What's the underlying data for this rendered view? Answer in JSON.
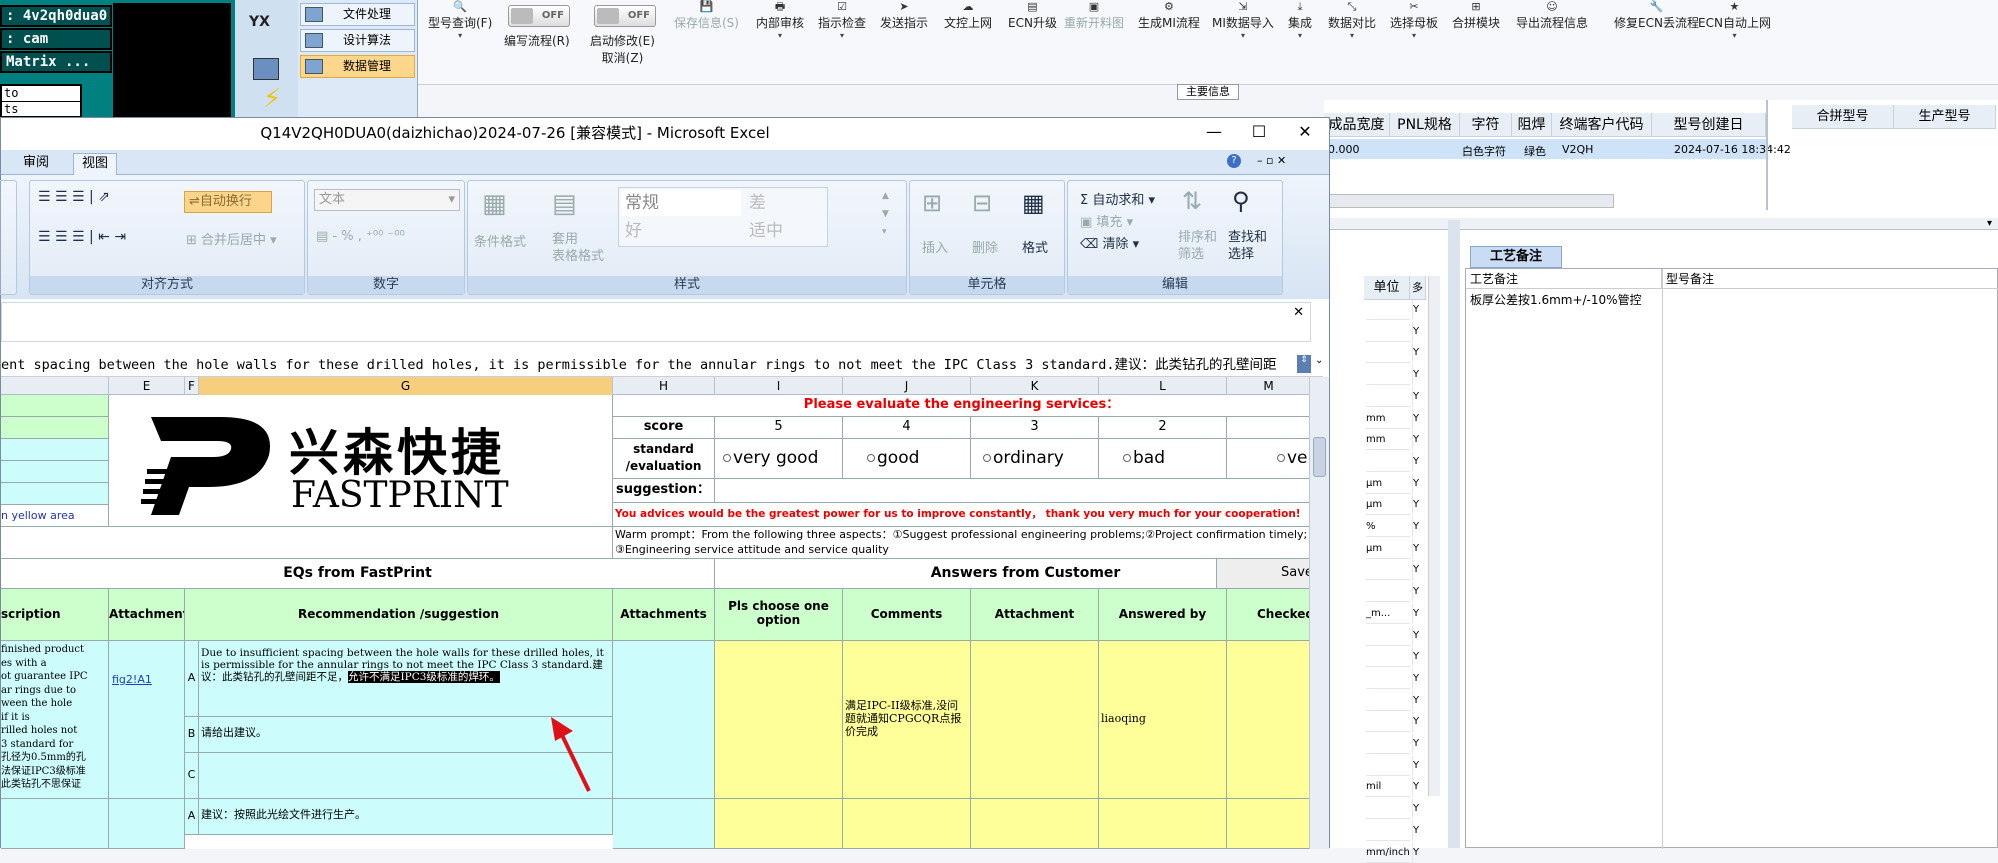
{
  "terminal": {
    "lines": [
      ": 4v2qh0dua0",
      ": cam",
      "Matrix ..."
    ],
    "input_lines": [
      "to",
      "ts"
    ]
  },
  "side_menu": {
    "items": [
      {
        "label": "文件处理",
        "selected": false
      },
      {
        "label": "设计算法",
        "selected": false
      },
      {
        "label": "数据管理",
        "selected": true
      }
    ]
  },
  "toolbar": {
    "items": [
      {
        "label": "型号查询(F)",
        "icon": "search-icon",
        "disabled": false
      },
      {
        "label": "编写流程(R)",
        "icon": "toggle",
        "disabled": false
      },
      {
        "label": "启动修改(E)",
        "icon": "toggle",
        "disabled": false
      },
      {
        "label": "保存信息(S)",
        "icon": "save-icon",
        "disabled": true
      },
      {
        "label": "内部审核",
        "icon": "print-icon",
        "disabled": false
      },
      {
        "label": "指示检查",
        "icon": "check-icon",
        "disabled": false
      },
      {
        "label": "发送指示",
        "icon": "send-icon",
        "disabled": false
      },
      {
        "label": "文控上网",
        "icon": "upload-icon",
        "disabled": false
      },
      {
        "label": "ECN升级",
        "icon": "doc-icon",
        "disabled": false
      },
      {
        "label": "重新开料图",
        "icon": "image-icon",
        "disabled": true
      },
      {
        "label": "生成MI流程",
        "icon": "flow-icon",
        "disabled": false
      },
      {
        "label": "MI数据导入",
        "icon": "import-icon",
        "disabled": false
      },
      {
        "label": "集成",
        "icon": "download-icon",
        "disabled": false
      },
      {
        "label": "数据对比",
        "icon": "compare-icon",
        "disabled": false
      },
      {
        "label": "选择母板",
        "icon": "select-icon",
        "disabled": false
      },
      {
        "label": "合拼模块",
        "icon": "merge-icon",
        "disabled": false
      },
      {
        "label": "导出流程信息",
        "icon": "export-icon",
        "disabled": false
      },
      {
        "label": "修复ECN丢流程",
        "icon": "wrench-icon",
        "disabled": false
      },
      {
        "label": "ECN自动上网",
        "icon": "star-icon",
        "disabled": false
      }
    ],
    "toggle_off": "OFF",
    "cancel_label": "取消(Z)",
    "main_info": "主要信息"
  },
  "right_grid": {
    "headers": [
      "成品宽度",
      "PNL规格",
      "字符",
      "阻焊",
      "终端客户代码",
      "型号创建日"
    ],
    "row": [
      "0.000",
      "",
      "白色字符",
      "绿色",
      "V2QH",
      "2024-07-16 18:34:42"
    ],
    "merge_headers": [
      "合拼型号",
      "生产型号"
    ],
    "panel_tab": "工艺备注",
    "panel_col1": "工艺备注",
    "panel_col2": "型号备注",
    "panel_note": "板厚公差按1.6mm+/-10%管控",
    "unit_header": "单位",
    "more_header": "多",
    "units": [
      "",
      "",
      "",
      "",
      "",
      "mm",
      "mm",
      "",
      "µm",
      "µm",
      "%",
      "µm",
      "",
      "",
      "_m...",
      "",
      "",
      "",
      "",
      "",
      "",
      "",
      "mil",
      "",
      "",
      "mm/inch"
    ],
    "flags": "Y"
  },
  "excel": {
    "title": "Q14V2QH0DUA0(daizhichao)2024-07-26  [兼容模式] - Microsoft Excel",
    "tabs": [
      "审阅",
      "视图"
    ],
    "ribbon": {
      "wrap": "自动换行",
      "merge": "合并后居中",
      "align_group": "对齐方式",
      "number_format": "文本",
      "number_group": "数字",
      "percent": "%",
      "cond_format": "条件格式",
      "table_format": "套用\n表格格式",
      "style_normal": "常规",
      "style_bad": "差",
      "style_good": "好",
      "style_neutral": "适中",
      "style_group": "样式",
      "insert": "插入",
      "delete": "删除",
      "format": "格式",
      "cells_group": "单元格",
      "autosum": "自动求和",
      "fill": "填充",
      "clear": "清除",
      "sort": "排序和\n筛选",
      "find": "查找和\n选择",
      "edit_group": "编辑"
    },
    "formula_text": "ent spacing between the hole walls for these drilled holes, it is permissible for the annular rings to not meet the IPC Class 3 standard.建议：此类钻孔的孔壁间距",
    "columns": [
      "E",
      "F",
      "G",
      "H",
      "I",
      "J",
      "K",
      "L",
      "M"
    ],
    "sheet": {
      "eval_title": "Please evaluate the engineering services：",
      "score_label": "score",
      "scores": [
        "5",
        "4",
        "3",
        "2"
      ],
      "std_label": "standard\n/evaluation",
      "ratings": [
        "very good",
        "good",
        "ordinary",
        "bad",
        "ve"
      ],
      "suggestion_label": "suggestion：",
      "yellow_area": "n yellow area",
      "brand_cn": "兴森快捷",
      "brand_en": "FASTPRINT",
      "advice": "You advices would be the greatest power for us to improve constantly， thank you very much for your cooperation!",
      "warm": "Warm prompt：From the following three aspects：①Suggest professional engineering problems;②Project confirmation timely;\n③Engineering service attitude and service quality",
      "eqs_header": "EQs from FastPrint",
      "answers_header": "Answers from Customer",
      "save_btn": "Save",
      "col_desc": "scription",
      "col_attach": "Attachment",
      "col_rec": "Recommendation /suggestion",
      "col_attachments": "Attachments",
      "col_choose": "Pls choose one option",
      "col_comments": "Comments",
      "col_attachment2": "Attachment",
      "col_answered": "Answered by",
      "col_checked": "Checked I",
      "desc_text": "finished product\nes with a\not guarantee IPC\nar rings due to\nween the hole\nif it is\nrilled holes not\n3 standard for\n孔径为0.5mm的孔\n法保证IPC3级标准\n此类钻孔不思保证",
      "link": "fig2!A1",
      "opt_a": "A",
      "opt_b": "B",
      "opt_c": "C",
      "rec_a": "Due to insufficient spacing between the hole walls for these drilled holes, it is permissible for the annular rings to not meet the IPC Class 3 standard.建议：此类钻孔的孔壁间距不足，",
      "rec_a_hl": "允许不满足IPC3级标准的焊环。",
      "rec_b": "请给出建议。",
      "comment": "满足IPC-II级标准,没问题就通知CPGCQR点报价完成",
      "answered_by": "liaoqing",
      "rec_next": "建议：按照此光绘文件进行生产。"
    }
  }
}
